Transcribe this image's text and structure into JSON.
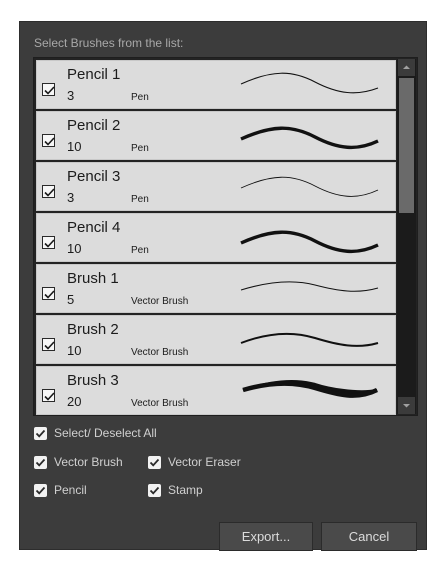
{
  "dialog": {
    "header": "Select Brushes from the list:",
    "brushes": [
      {
        "name": "Pencil 1",
        "size": "3",
        "type": "Pen",
        "checked": true
      },
      {
        "name": "Pencil 2",
        "size": "10",
        "type": "Pen",
        "checked": true
      },
      {
        "name": "Pencil 3",
        "size": "3",
        "type": "Pen",
        "checked": true
      },
      {
        "name": "Pencil 4",
        "size": "10",
        "type": "Pen",
        "checked": true
      },
      {
        "name": "Brush 1",
        "size": "5",
        "type": "Vector Brush",
        "checked": true
      },
      {
        "name": "Brush 2",
        "size": "10",
        "type": "Vector Brush",
        "checked": true
      },
      {
        "name": "Brush 3",
        "size": "20",
        "type": "Vector Brush",
        "checked": true
      }
    ],
    "options": {
      "select_all": "Select/ Deselect All",
      "vector_brush": "Vector Brush",
      "vector_eraser": "Vector Eraser",
      "pencil": "Pencil",
      "stamp": "Stamp"
    },
    "buttons": {
      "export": "Export...",
      "cancel": "Cancel"
    }
  },
  "colors": {
    "dialog_bg": "#3c3c3c",
    "list_item_bg": "#dcdcdc",
    "scrollbar_thumb": "#6a6a6a"
  },
  "icons": [
    "check-icon",
    "scroll-up-arrow-icon",
    "scroll-down-arrow-icon"
  ]
}
